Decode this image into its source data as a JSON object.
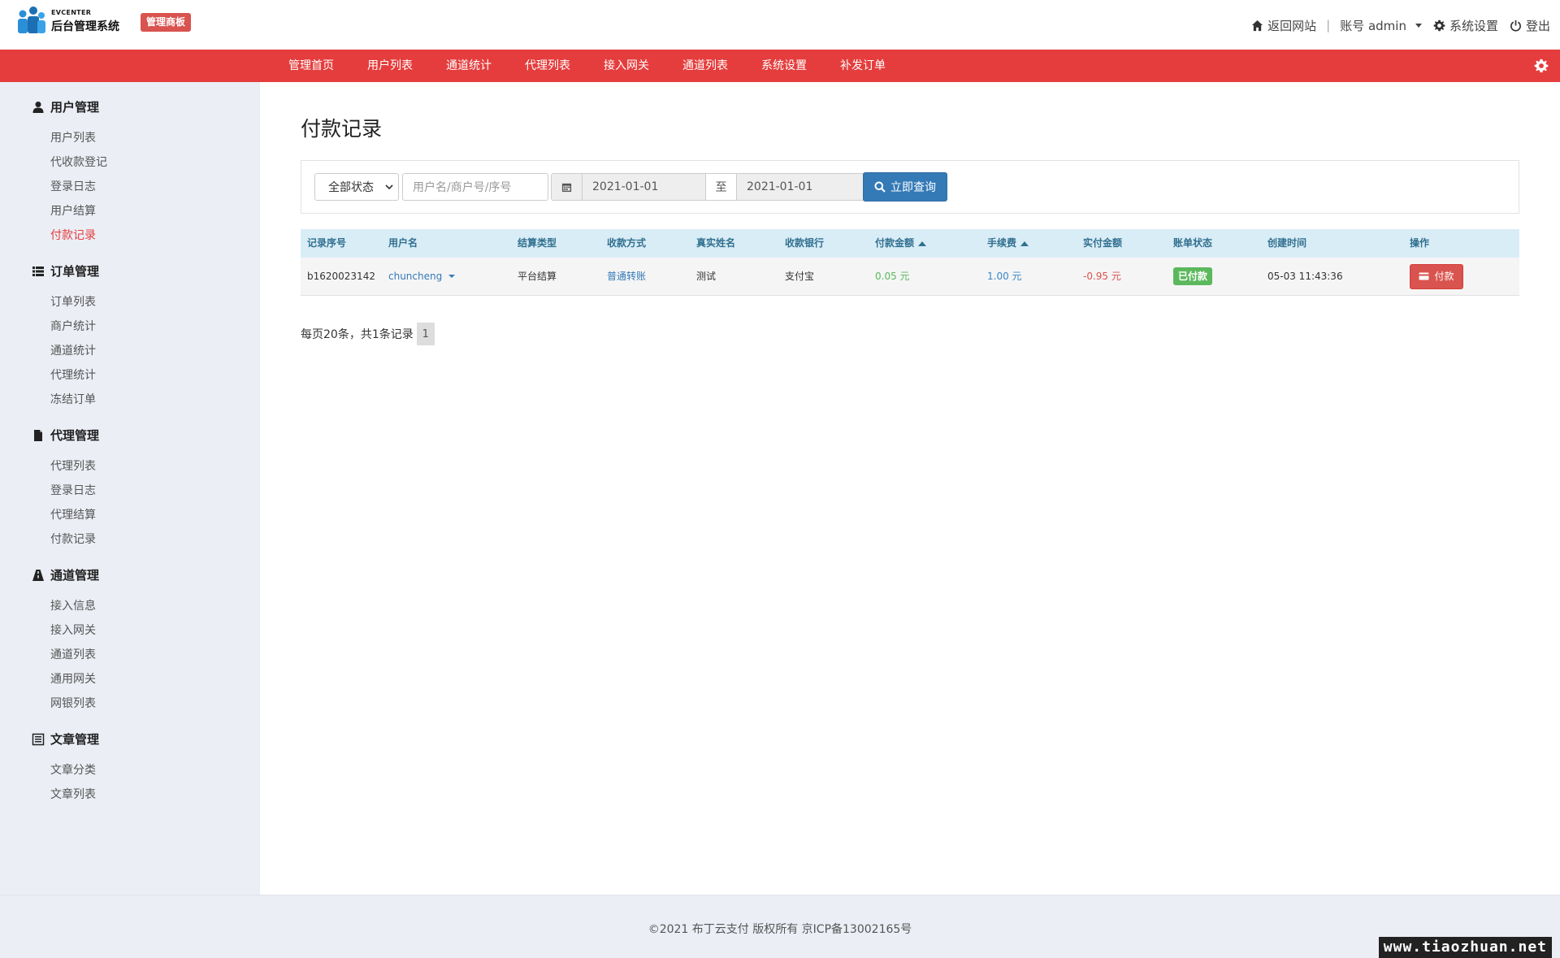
{
  "brand": {
    "logo_sub": "EVCENTER",
    "logo_main": "后台管理系统",
    "badge": "管理商板"
  },
  "top_right": {
    "home_link": "返回网站",
    "account": "账号 admin",
    "settings": "系统设置",
    "logout": "登出"
  },
  "nav": {
    "items": [
      "管理首页",
      "用户列表",
      "通道统计",
      "代理列表",
      "接入网关",
      "通道列表",
      "系统设置",
      "补发订单"
    ]
  },
  "sidebar": {
    "groups": [
      {
        "title": "用户管理",
        "icon": "user-icon",
        "items": [
          "用户列表",
          "代收款登记",
          "登录日志",
          "用户结算",
          "付款记录"
        ]
      },
      {
        "title": "订单管理",
        "icon": "list-icon",
        "items": [
          "订单列表",
          "商户统计",
          "通道统计",
          "代理统计",
          "冻结订单"
        ]
      },
      {
        "title": "代理管理",
        "icon": "file-icon",
        "items": [
          "代理列表",
          "登录日志",
          "代理结算",
          "付款记录"
        ]
      },
      {
        "title": "通道管理",
        "icon": "road-icon",
        "items": [
          "接入信息",
          "接入网关",
          "通道列表",
          "通用网关",
          "网银列表"
        ]
      },
      {
        "title": "文章管理",
        "icon": "article-icon",
        "items": [
          "文章分类",
          "文章列表"
        ]
      }
    ],
    "active_item": "付款记录"
  },
  "page": {
    "title": "付款记录"
  },
  "filter": {
    "status_selected": "全部状态",
    "keyword_placeholder": "用户名/商户号/序号",
    "date_from": "2021-01-01",
    "date_sep": "至",
    "date_to": "2021-01-01",
    "search_label": "立即查询"
  },
  "table": {
    "headers": [
      "记录序号",
      "用户名",
      "结算类型",
      "收款方式",
      "真实姓名",
      "收款银行",
      "付款金额",
      "手续费",
      "实付金额",
      "账单状态",
      "创建时间",
      "操作"
    ],
    "rows": [
      {
        "id": "b1620023142",
        "username": "chuncheng",
        "settle_type": "平台结算",
        "pay_method": "普通转账",
        "real_name": "测试",
        "bank": "支付宝",
        "amount": "0.05 元",
        "fee": "1.00 元",
        "actual": "-0.95 元",
        "status": "已付款",
        "created": "05-03 11:43:36",
        "action": "付款"
      }
    ]
  },
  "pager": {
    "summary": "每页20条，共1条记录",
    "current": "1"
  },
  "footer": {
    "text": "©2021   布丁云支付 版权所有   京ICP备13002165号"
  },
  "watermark": "www.tiaozhuan.net",
  "colors": {
    "nav_red": "#e53d3d",
    "sidebar_bg": "#ebeef5",
    "table_head_bg": "#d9edf7",
    "primary_blue": "#337ab7",
    "success_green": "#5cb85c",
    "danger_red": "#d9534f"
  }
}
